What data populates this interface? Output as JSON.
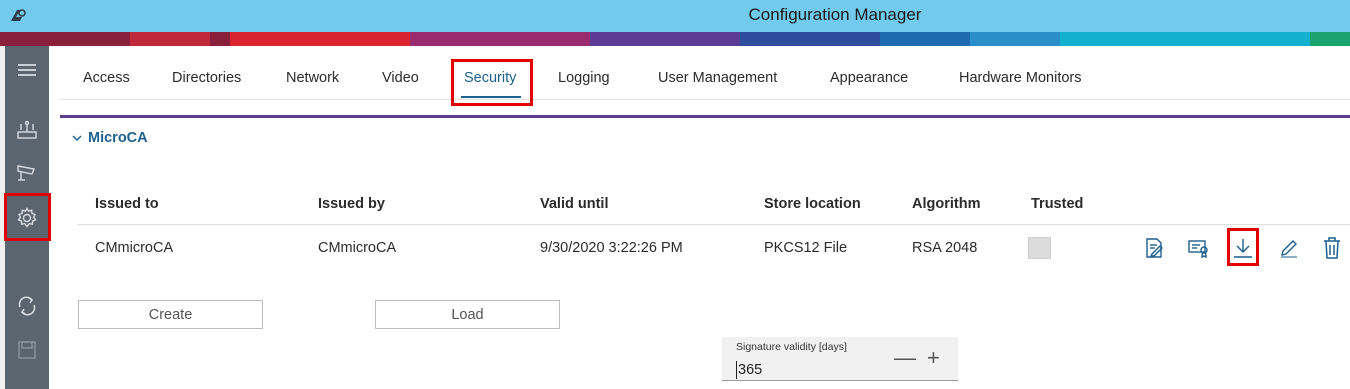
{
  "window": {
    "title": "Configuration Manager",
    "app_icon": "config-manager-icon"
  },
  "colors": {
    "title_bar": "#72cbec",
    "rail": "#5a6570",
    "accent": "#1d5f8d",
    "section_line": "#5b3d8c",
    "highlight": "#e00000",
    "band": [
      "#8a1f3c",
      "#c0283c",
      "#d9232f",
      "#9a2b6e",
      "#5c3c94",
      "#2f4c9c",
      "#1f6bb0",
      "#2a8fc8",
      "#13b0cf",
      "#1aa36e"
    ]
  },
  "rail": {
    "items": [
      {
        "name": "menu-icon"
      },
      {
        "name": "devices-icon"
      },
      {
        "name": "cameras-icon"
      },
      {
        "name": "settings-icon",
        "highlighted": true
      },
      {
        "name": "refresh-icon"
      },
      {
        "name": "save-icon"
      }
    ]
  },
  "tabs": [
    {
      "label": "Access"
    },
    {
      "label": "Directories"
    },
    {
      "label": "Network"
    },
    {
      "label": "Video"
    },
    {
      "label": "Security",
      "active": true
    },
    {
      "label": "Logging"
    },
    {
      "label": "User Management"
    },
    {
      "label": "Appearance"
    },
    {
      "label": "Hardware Monitors"
    }
  ],
  "section": {
    "title": "MicroCA",
    "expanded": true,
    "table": {
      "columns": [
        "Issued to",
        "Issued by",
        "Valid until",
        "Store location",
        "Algorithm",
        "Trusted"
      ],
      "rows": [
        {
          "issued_to": "CMmicroCA",
          "issued_by": "CMmicroCA",
          "valid_until": "9/30/2020 3:22:26 PM",
          "store_location": "PKCS12 File",
          "algorithm": "RSA 2048",
          "trusted": false
        }
      ],
      "row_actions": [
        "sign-certificate-icon",
        "certificate-icon",
        "download-icon",
        "edit-icon",
        "delete-icon"
      ]
    },
    "buttons": {
      "create": "Create",
      "load": "Load"
    },
    "signature_validity": {
      "label": "Signature validity [days]",
      "value": "365",
      "decrement": "—",
      "increment": "+"
    }
  }
}
